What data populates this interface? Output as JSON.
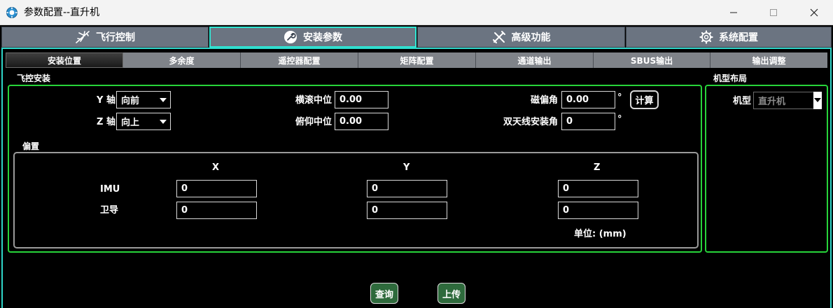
{
  "window": {
    "title": "参数配置--直升机",
    "app_icon": "gear-app-icon",
    "controls": {
      "minimize": "—",
      "maximize": "☐",
      "close": "✕"
    }
  },
  "main_tabs": [
    {
      "label": "飞行控制",
      "icon": "airplane-icon"
    },
    {
      "label": "安装参数",
      "icon": "wrench-icon",
      "active": true
    },
    {
      "label": "高级功能",
      "icon": "tools-icon"
    },
    {
      "label": "系统配置",
      "icon": "gear-icon"
    }
  ],
  "sub_tabs": [
    {
      "label": "安装位置",
      "active": true
    },
    {
      "label": "多余度"
    },
    {
      "label": "遥控器配置"
    },
    {
      "label": "矩阵配置"
    },
    {
      "label": "通道输出"
    },
    {
      "label": "SBUS输出"
    },
    {
      "label": "输出调整"
    }
  ],
  "mount": {
    "section_title": "飞控安装",
    "y_axis": {
      "label": "Y 轴",
      "value": "向前"
    },
    "z_axis": {
      "label": "Z 轴",
      "value": "向上"
    },
    "roll_center": {
      "label": "横滚中位",
      "value": "0.00"
    },
    "pitch_center": {
      "label": "俯仰中位",
      "value": "0.00"
    },
    "mag_declination": {
      "label": "磁偏角",
      "value": "0.00",
      "unit": "°"
    },
    "dual_antenna": {
      "label": "双天线安装角",
      "value": "0",
      "unit": "°"
    },
    "calc_button": "计算"
  },
  "offset": {
    "section_title": "偏置",
    "columns": [
      "X",
      "Y",
      "Z"
    ],
    "rows": [
      {
        "label": "IMU",
        "values": [
          "0",
          "0",
          "0"
        ]
      },
      {
        "label": "卫导",
        "values": [
          "0",
          "0",
          "0"
        ]
      }
    ],
    "unit_label": "单位: (mm)"
  },
  "layout_panel": {
    "section_title": "机型布局",
    "model_label": "机型",
    "model_value": "直升机"
  },
  "actions": {
    "query": "查询",
    "upload": "上传"
  },
  "colors": {
    "accent_cyan": "#2fe6d3",
    "group_green": "#27d43a",
    "tab_gray": "#6b7481",
    "button_green": "#2e6a3c"
  }
}
